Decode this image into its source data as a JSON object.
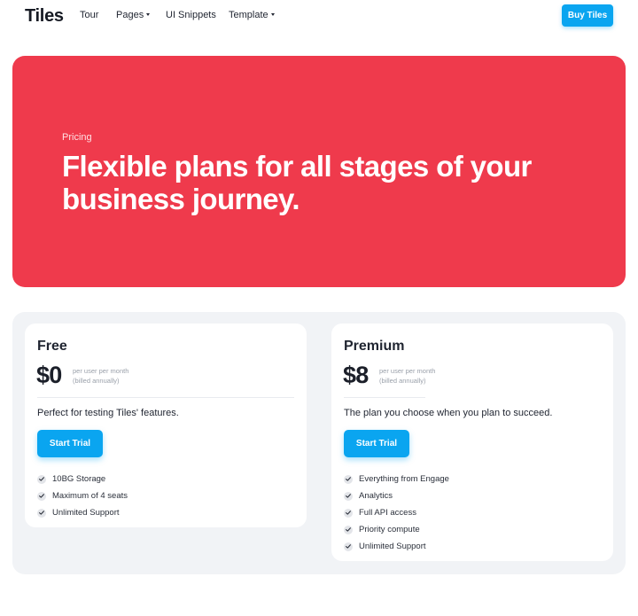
{
  "nav": {
    "logo": "Tiles",
    "items": [
      {
        "label": "Tour"
      },
      {
        "label": "Pages"
      },
      {
        "label": "UI Snippets"
      },
      {
        "label": "Template"
      }
    ],
    "cta": "Buy Tiles"
  },
  "hero": {
    "eyebrow": "Pricing",
    "title": "Flexible plans for all stages of your business journey."
  },
  "plans": [
    {
      "name": "Free",
      "price": "$0",
      "note_line1": "per user per month",
      "note_line2": "(billed annually)",
      "tagline": "Perfect for testing Tiles' features.",
      "cta": "Start Trial",
      "features": [
        "10BG Storage",
        "Maximum of 4 seats",
        "Unlimited Support"
      ]
    },
    {
      "name": "Premium",
      "price": "$8",
      "note_line1": "per user per month",
      "note_line2": "(billed annually)",
      "tagline": "The plan you choose when you plan to succeed.",
      "cta": "Start Trial",
      "features": [
        "Everything from Engage",
        "Analytics",
        "Full API access",
        "Priority compute",
        "Unlimited Support"
      ]
    }
  ],
  "colors": {
    "brand_accent": "#0aa5f0",
    "hero_background": "#ef3a4c",
    "pricing_background": "#f1f3f6"
  },
  "icons": {
    "dropdown": "caret-down-icon",
    "feature_bullet": "check-icon"
  }
}
